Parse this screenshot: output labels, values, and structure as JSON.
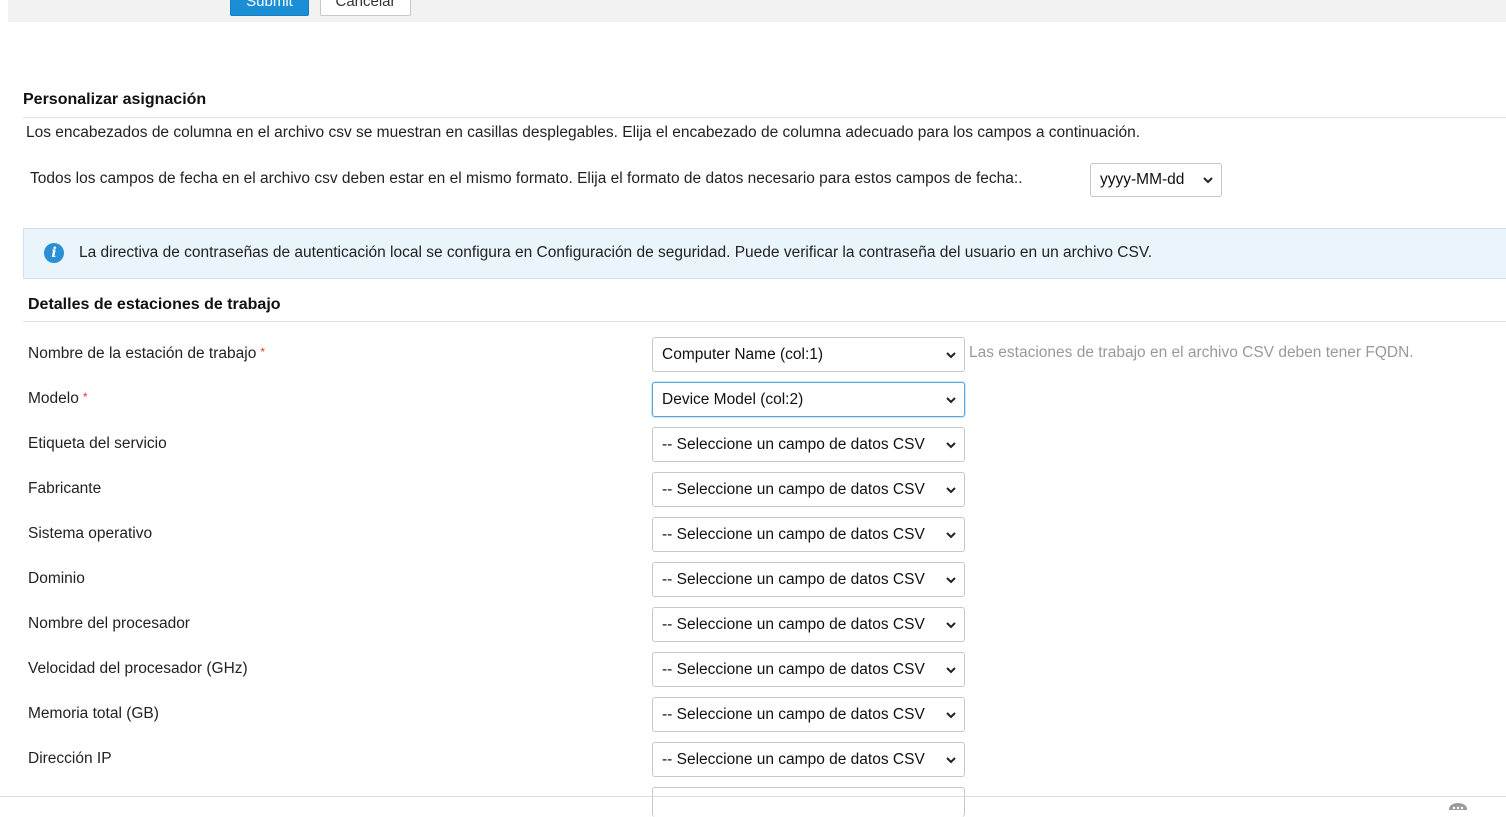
{
  "toolbar": {
    "submit_label": "Submit",
    "cancel_label": "Cancelar"
  },
  "mapping": {
    "title": "Personalizar asignación",
    "description": "Los encabezados de columna en el archivo csv se muestran en casillas desplegables. Elija el encabezado de columna adecuado para los campos a continuación.",
    "date_format_label": "Todos los campos de fecha en el archivo csv deben estar en el mismo formato. Elija el formato de datos necesario para estos campos de fecha:.",
    "date_format_value": "yyyy-MM-dd"
  },
  "info": {
    "icon": "info-icon",
    "text": "La directiva de contraseñas de autenticación local se configura en Configuración de seguridad. Puede verificar la contraseña del usuario en un archivo CSV."
  },
  "workstation": {
    "title": "Detalles de estaciones de trabajo",
    "hint": "Las estaciones de trabajo en el archivo CSV deben tener FQDN.",
    "fields": [
      {
        "label": "Nombre de la estación de trabajo",
        "required": true,
        "value": "Computer Name (col:1)"
      },
      {
        "label": "Modelo",
        "required": true,
        "value": "Device Model (col:2)"
      },
      {
        "label": "Etiqueta del servicio",
        "required": false,
        "value": "-- Seleccione un campo de datos CSV"
      },
      {
        "label": "Fabricante",
        "required": false,
        "value": "-- Seleccione un campo de datos CSV"
      },
      {
        "label": "Sistema operativo",
        "required": false,
        "value": "-- Seleccione un campo de datos CSV"
      },
      {
        "label": "Dominio",
        "required": false,
        "value": "-- Seleccione un campo de datos CSV"
      },
      {
        "label": "Nombre del procesador",
        "required": false,
        "value": "-- Seleccione un campo de datos CSV"
      },
      {
        "label": "Velocidad del procesador (GHz)",
        "required": false,
        "value": "-- Seleccione un campo de datos CSV"
      },
      {
        "label": "Memoria total (GB)",
        "required": false,
        "value": "-- Seleccione un campo de datos CSV"
      },
      {
        "label": "Dirección IP",
        "required": false,
        "value": "-- Seleccione un campo de datos CSV"
      }
    ],
    "required_mark": "*"
  },
  "colors": {
    "primary": "#1a8fd6",
    "required": "#e53935",
    "info_bg": "#e9f4fb",
    "hint": "#999999"
  }
}
